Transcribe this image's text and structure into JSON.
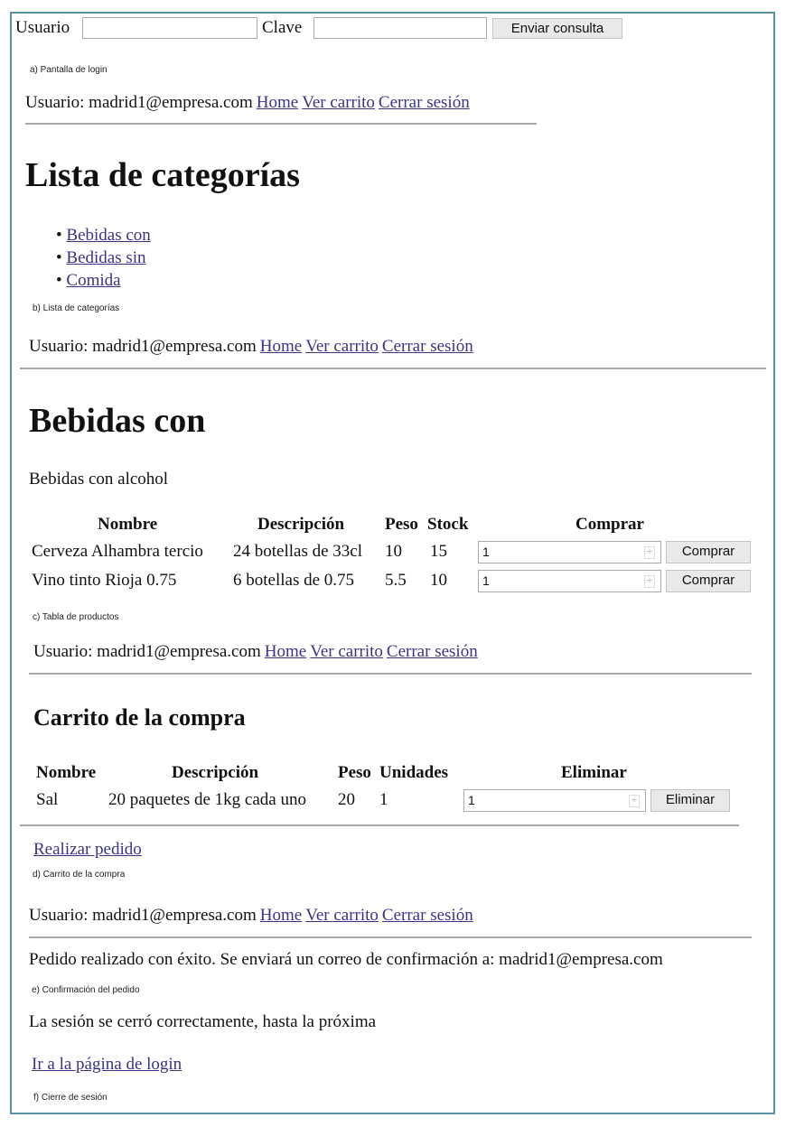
{
  "login": {
    "user_label": "Usuario",
    "user_value": "",
    "pass_label": "Clave",
    "pass_value": "",
    "submit": "Enviar consulta"
  },
  "captions": {
    "a": "a) Pantalla de login",
    "b": "b) Lista de categorías",
    "c": "c) Tabla de productos",
    "d": "d) Carrito de la compra",
    "e": "e) Confirmación del pedido",
    "f": "f) Cierre de sesión"
  },
  "nav": {
    "user": "Usuario: madrid1@empresa.com",
    "home": "Home",
    "cart": "Ver carrito",
    "logout": "Cerrar sesión"
  },
  "categories": {
    "title": "Lista de categorías",
    "items": [
      "Bebidas con",
      "Bedidas sin",
      "Comida"
    ]
  },
  "products": {
    "title": "Bebidas con",
    "description": "Bebidas con alcohol",
    "headers": [
      "Nombre",
      "Descripción",
      "Peso",
      "Stock",
      "Comprar"
    ],
    "rows": [
      {
        "name": "Cerveza Alhambra tercio",
        "desc": "24 botellas de 33cl",
        "peso": "10",
        "stock": "15",
        "qty": "1",
        "button": "Comprar"
      },
      {
        "name": "Vino tinto Rioja 0.75",
        "desc": "6 botellas de 0.75",
        "peso": "5.5",
        "stock": "10",
        "qty": "1",
        "button": "Comprar"
      }
    ]
  },
  "cart": {
    "title": "Carrito de la compra",
    "headers": [
      "Nombre",
      "Descripción",
      "Peso",
      "Unidades",
      "Eliminar"
    ],
    "rows": [
      {
        "name": "Sal",
        "desc": "20 paquetes de 1kg cada uno",
        "peso": "20",
        "units": "1",
        "qty": "1",
        "button": "Eliminar"
      }
    ],
    "checkout": "Realizar pedido"
  },
  "confirmation": "Pedido realizado con éxito. Se enviará un correo de confirmación a: madrid1@empresa.com",
  "logout": {
    "message": "La sesión se cerró correctamente, hasta la próxima",
    "link": "Ir a la página de login"
  },
  "colors": {
    "frame": "#5a93a6",
    "link": "#3b3486"
  }
}
